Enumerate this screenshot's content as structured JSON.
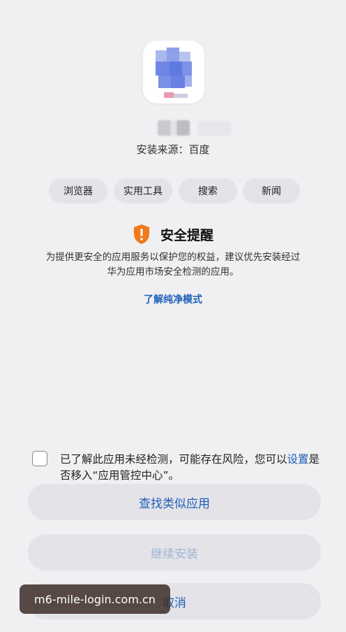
{
  "app": {
    "source_label": "安装来源：百度",
    "tags": [
      "浏览器",
      "实用工具",
      "搜索",
      "新闻"
    ]
  },
  "alert": {
    "icon": "shield-warning-icon",
    "accent_color": "#f07a1a",
    "title": "安全提醒",
    "description_line1": "为提供更安全的应用服务以保护您的权益，建议优先安装经过",
    "description_line2": "华为应用市场安全检测的应用。",
    "learn_more_link": "了解纯净模式"
  },
  "consent": {
    "checked": false,
    "text_part1": "已了解此应用未经检测，可能存在风险，您可以",
    "settings_link": "设置",
    "text_part2": "是否移入“应用管控中心”。"
  },
  "buttons": {
    "find_similar": "查找类似应用",
    "continue_install": "继续安装",
    "cancel": "取消"
  },
  "overlay": {
    "url_text": "m6-mile-login.com.cn"
  },
  "colors": {
    "background": "#f0eff1",
    "link_blue": "#1f5fb8",
    "disabled_blue": "#9fb4d6",
    "button_bg": "#e4e3e8"
  }
}
